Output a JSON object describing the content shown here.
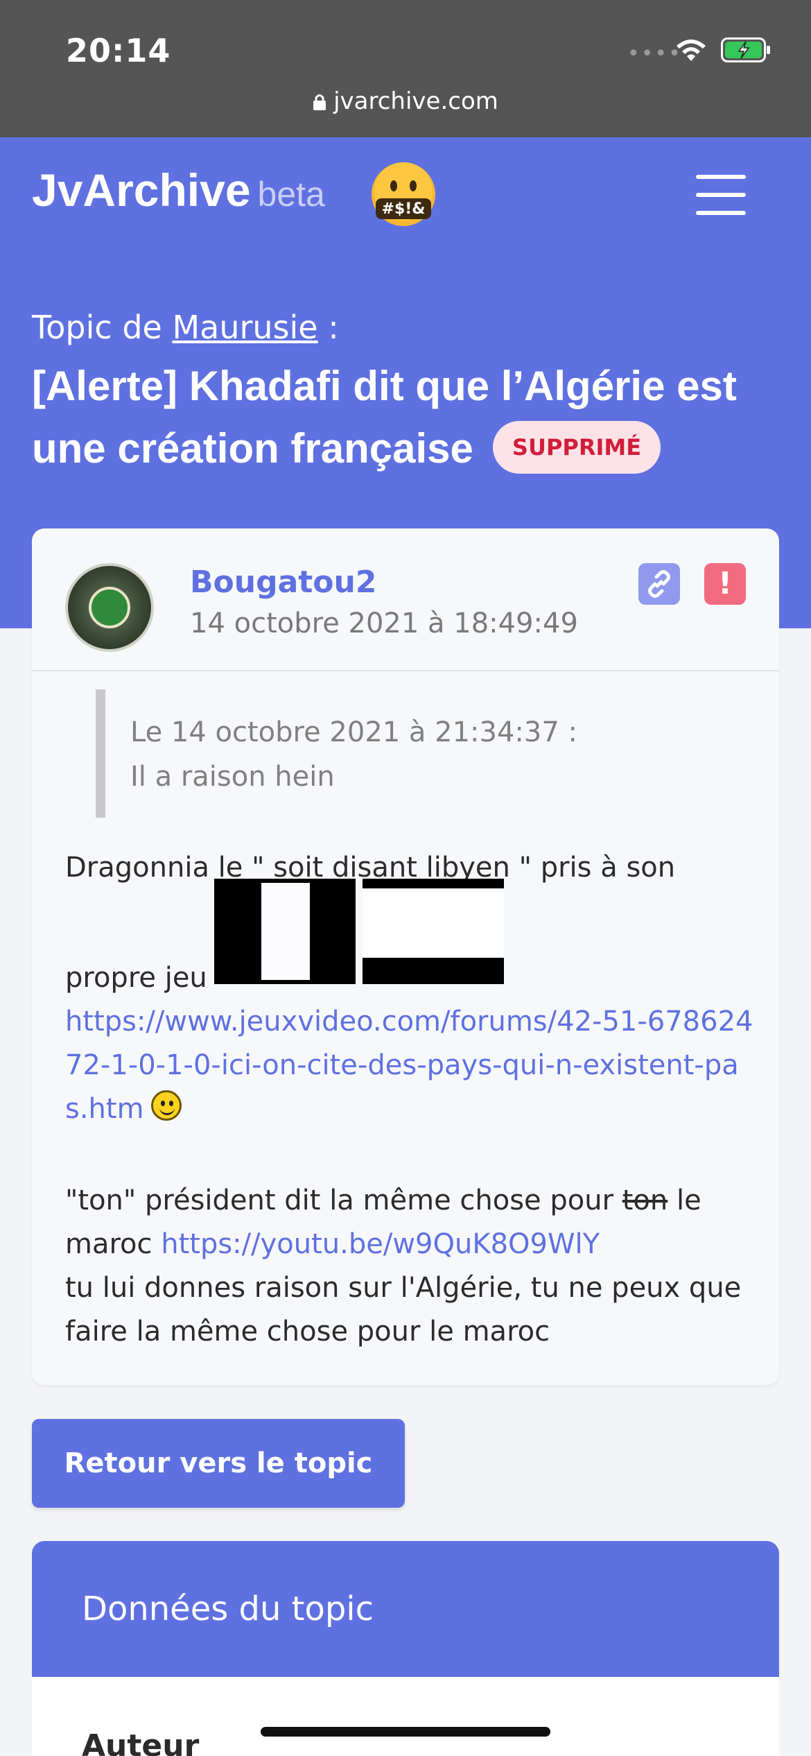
{
  "status_bar": {
    "time": "20:14",
    "url": "jvarchive.com"
  },
  "header": {
    "logo": "JvArchive",
    "logo_suffix": "beta",
    "emoji_text": "#$!&"
  },
  "topic": {
    "prefix": "Topic de",
    "author": "Maurusie",
    "suffix": " :",
    "title": "[Alerte] Khadafi dit que l’Algérie est une création française",
    "badge": "SUPPRIMÉ"
  },
  "post": {
    "author": "Bougatou2",
    "date": "14 octobre 2021 à 18:49:49",
    "report_icon_text": "!",
    "quote": {
      "header": "Le 14 octobre 2021 à 21:34:37 :",
      "text": "Il a raison hein"
    },
    "paragraph1": {
      "text_a": "Dragonnia le \" soit disant libyen \" pris à son",
      "text_b": "propre jeu",
      "link": "https://www.jeuxvideo.com/forums/42-51-67862472-1-0-1-0-ici-on-cite-des-pays-qui-n-existent-pas.htm"
    },
    "paragraph2": {
      "text_a": "\"ton\" président dit la même chose pour ",
      "strike": "ton",
      "text_b": " le maroc ",
      "link": "https://youtu.be/w9QuK8O9WlY",
      "text_c": "tu lui donnes raison sur l'Algérie, tu ne peux que faire la même chose pour le maroc"
    }
  },
  "back_button": "Retour vers le topic",
  "panel": {
    "title": "Données du topic",
    "first_row_label": "Auteur"
  },
  "colors": {
    "brand": "#5f71e0",
    "deleted_badge_bg": "#fde3e7",
    "deleted_badge_text": "#d21d3c",
    "report": "#f36b7f"
  }
}
